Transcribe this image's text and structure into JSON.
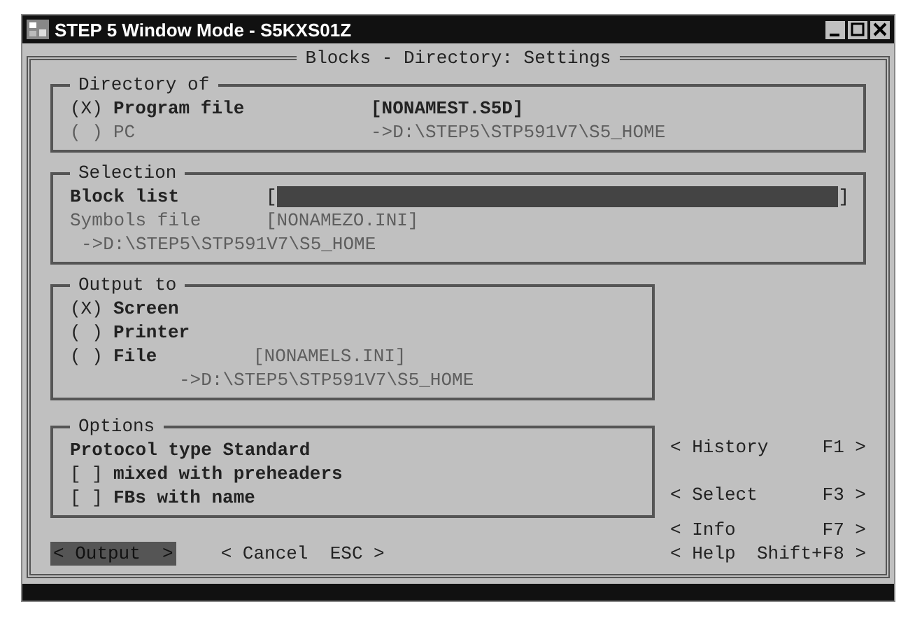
{
  "window": {
    "title": "STEP 5 Window Mode - S5KXS01Z"
  },
  "dialog_title": "Blocks - Directory: Settings",
  "directory": {
    "title": "Directory of",
    "options": [
      {
        "marker": "(X)",
        "label": "Program file",
        "value": "[NONAMEST.S5D]",
        "disabled": false
      },
      {
        "marker": "( )",
        "label": "PC",
        "value": "->D:\\STEP5\\STP591V7\\S5_HOME",
        "disabled": true
      }
    ]
  },
  "selection": {
    "title": "Selection",
    "block_list_label": "Block list",
    "open_bracket": "[",
    "close_bracket": "]",
    "symbols_label": "Symbols file",
    "symbols_value": "[NONAMEZO.INI]",
    "symbols_path": "->D:\\STEP5\\STP591V7\\S5_HOME",
    "symbols_disabled": true
  },
  "output_to": {
    "title": "Output to",
    "options": [
      {
        "marker": "(X)",
        "label": "Screen"
      },
      {
        "marker": "( )",
        "label": "Printer"
      },
      {
        "marker": "( )",
        "label": "File",
        "value": "[NONAMELS.INI]",
        "path": "->D:\\STEP5\\STP591V7\\S5_HOME"
      }
    ]
  },
  "options": {
    "title": "Options",
    "protocol": "Protocol type Standard",
    "checks": [
      {
        "marker": "[ ]",
        "label": "mixed with preheaders"
      },
      {
        "marker": "[ ]",
        "label": "FBs with name"
      }
    ]
  },
  "side_buttons": [
    {
      "label": "< History",
      "key": "F1 >"
    },
    {
      "label": "< Select",
      "key": "F3 >"
    }
  ],
  "bottom_buttons": [
    {
      "label": "< Output  >",
      "selected": true
    },
    {
      "label": "< Cancel  ESC >",
      "selected": false
    }
  ],
  "help_buttons": [
    {
      "label": "< Info",
      "key": "F7 >"
    },
    {
      "label": "< Help",
      "key": "Shift+F8 >"
    }
  ]
}
